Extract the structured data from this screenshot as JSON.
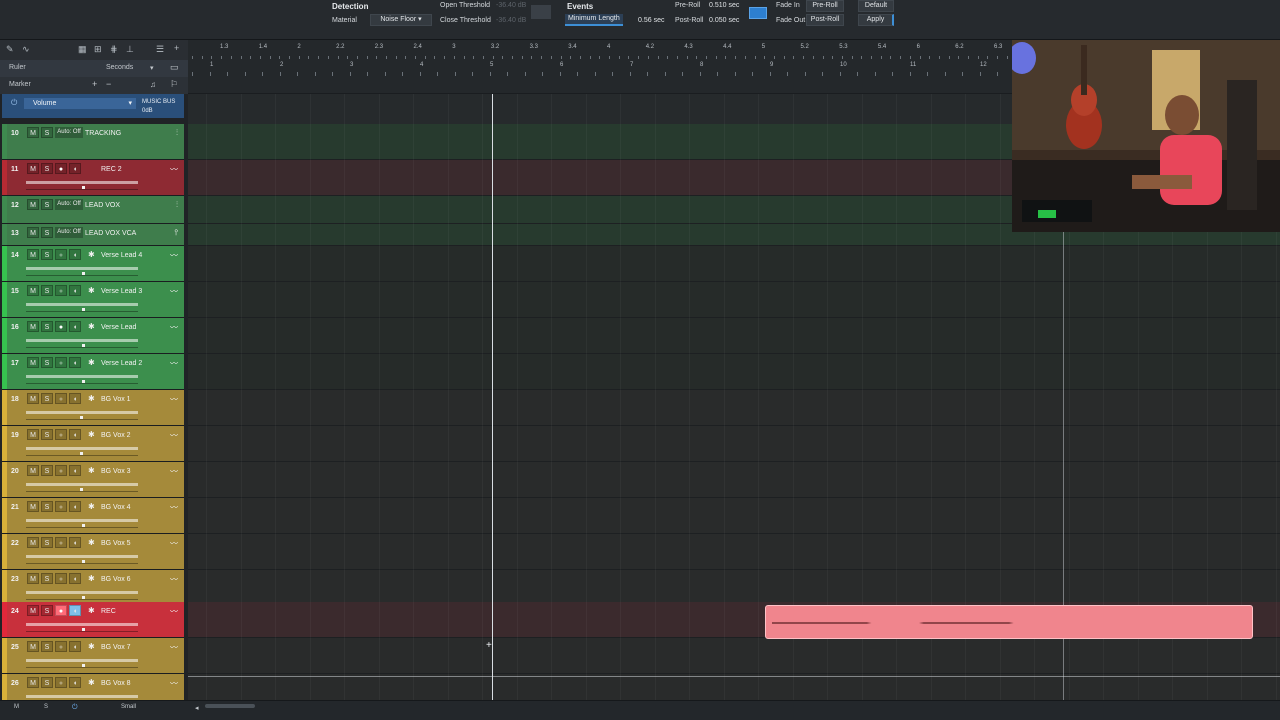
{
  "detection": {
    "title": "Detection",
    "material_label": "Material",
    "material_value": "Noise Floor",
    "open_threshold_label": "Open Threshold",
    "open_threshold_value": "-36.40 dB",
    "close_threshold_label": "Close Threshold",
    "close_threshold_value": "-36.40 dB"
  },
  "events": {
    "title": "Events",
    "min_length_label": "Minimum Length",
    "min_length_value": "0.56 sec",
    "preroll_label": "Pre-Roll",
    "preroll_value": "0.510 sec",
    "postroll_label": "Post-Roll",
    "postroll_value": "0.050 sec",
    "fadein_label": "Fade In",
    "fadeout_label": "Fade Out",
    "fadein_value": "Pre-Roll",
    "fadeout_value": "Post-Roll",
    "default_label": "Default",
    "apply_label": "Apply"
  },
  "header": {
    "ruler_label": "Ruler",
    "ruler_mode": "Seconds",
    "marker_label": "Marker"
  },
  "ruler": {
    "top_labels": [
      "1.3",
      "1.4",
      "2",
      "2.2",
      "2.3",
      "2.4",
      "3",
      "3.2",
      "3.3",
      "3.4",
      "4",
      "4.2",
      "4.3",
      "4.4",
      "5",
      "5.2",
      "5.3",
      "5.4",
      "6",
      "6.2",
      "6.3"
    ],
    "bottom_labels": [
      "1",
      "2",
      "3",
      "4",
      "5",
      "6",
      "7",
      "8",
      "9",
      "10",
      "11",
      "12"
    ]
  },
  "volume_row": {
    "label": "Volume",
    "bus": "MUSIC BUS",
    "db": "0dB"
  },
  "tracks": [
    {
      "num": "10",
      "name": "TRACKING",
      "type": "folder",
      "auto": "Auto: Off"
    },
    {
      "num": "11",
      "name": "REC 2",
      "type": "audio"
    },
    {
      "num": "12",
      "name": "LEAD VOX",
      "type": "folder",
      "auto": "Auto: Off"
    },
    {
      "num": "13",
      "name": "LEAD VOX VCA",
      "type": "vca",
      "auto": "Auto: Off"
    },
    {
      "num": "14",
      "name": "Verse Lead 4",
      "type": "audio"
    },
    {
      "num": "15",
      "name": "Verse Lead 3",
      "type": "audio"
    },
    {
      "num": "16",
      "name": "Verse Lead",
      "type": "audio"
    },
    {
      "num": "17",
      "name": "Verse Lead 2",
      "type": "audio"
    },
    {
      "num": "18",
      "name": "BG Vox 1",
      "type": "audio"
    },
    {
      "num": "19",
      "name": "BG Vox 2",
      "type": "audio"
    },
    {
      "num": "20",
      "name": "BG Vox 3",
      "type": "audio"
    },
    {
      "num": "21",
      "name": "BG Vox 4",
      "type": "audio"
    },
    {
      "num": "22",
      "name": "BG Vox 5",
      "type": "audio"
    },
    {
      "num": "23",
      "name": "BG Vox 6",
      "type": "audio"
    },
    {
      "num": "24",
      "name": "REC",
      "type": "audio"
    },
    {
      "num": "25",
      "name": "BG Vox 7",
      "type": "audio"
    },
    {
      "num": "26",
      "name": "BG Vox 8",
      "type": "audio"
    }
  ],
  "track_labels": {
    "mute": "M",
    "solo": "S"
  },
  "bottom": {
    "m": "M",
    "s": "S",
    "size": "Small"
  },
  "colors": {
    "green": "#3e8a4f",
    "red": "#c0303a",
    "gold": "#a58a3a",
    "blue": "#2a4f7a",
    "clip": "#f0858d"
  }
}
